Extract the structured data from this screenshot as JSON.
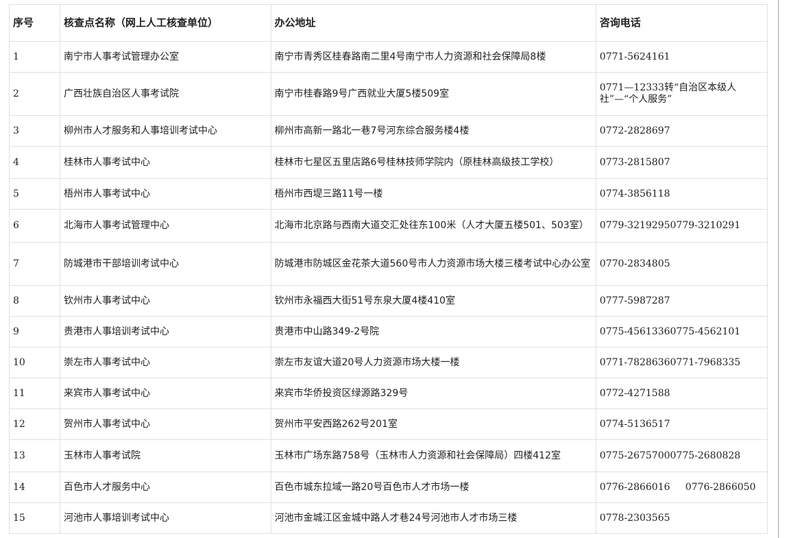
{
  "table": {
    "headers": [
      "序号",
      "核查点名称（网上人工核查单位）",
      "办公地址",
      "咨询电话"
    ],
    "rows": [
      {
        "no": "1",
        "name": "南宁市人事考试管理办公室",
        "address": "南宁市青秀区桂春路南二里4号南宁市人力资源和社会保障局8楼",
        "phone": "0771-5624161"
      },
      {
        "no": "2",
        "name": "广西壮族自治区人事考试院",
        "address": "南宁市桂春路9号广西就业大厦5楼509室",
        "phone": "0771—12333转“自治区本级人社”—“个人服务”"
      },
      {
        "no": "3",
        "name": "柳州市人才服务和人事培训考试中心",
        "address": "柳州市高新一路北一巷7号河东综合服务楼4楼",
        "phone": "0772-2828697"
      },
      {
        "no": "4",
        "name": "桂林市人事考试中心",
        "address": "桂林市七星区五里店路6号桂林技师学院内（原桂林高级技工学校）",
        "phone": "0773-2815807"
      },
      {
        "no": "5",
        "name": "梧州市人事考试中心",
        "address": "梧州市西堤三路11号一楼",
        "phone": "0774-3856118"
      },
      {
        "no": "6",
        "name": "北海市人事考试管理中心",
        "address": "北海市北京路与西南大道交汇处往东100米（人才大厦五楼501、503室）",
        "phone": "0779-32192950779-3210291"
      },
      {
        "no": "7",
        "name": "防城港市干部培训考试中心",
        "address": "防城港市防城区金花茶大道560号市人力资源市场大楼三楼考试中心办公室",
        "phone": "0770-2834805"
      },
      {
        "no": "8",
        "name": "钦州市人事考试中心",
        "address": "钦州市永福西大街51号东泉大厦4楼410室",
        "phone": "0777-5987287"
      },
      {
        "no": "9",
        "name": "贵港市人事培训考试中心",
        "address": "贵港市中山路349-2号院",
        "phone": "0775-45613360775-4562101"
      },
      {
        "no": "10",
        "name": "崇左市人事考试中心",
        "address": "崇左市友谊大道20号人力资源市场大楼一楼",
        "phone": "0771-78286360771-7968335"
      },
      {
        "no": "11",
        "name": "来宾市人事考试中心",
        "address": "来宾市华侨投资区绿源路329号",
        "phone": "0772-4271588"
      },
      {
        "no": "12",
        "name": "贺州市人事考试中心",
        "address": "贺州市平安西路262号201室",
        "phone": "0774-5136517"
      },
      {
        "no": "13",
        "name": "玉林市人事考试院",
        "address": "玉林市广场东路758号（玉林市人力资源和社会保障局）四楼412室",
        "phone": "0775-26757000775-2680828"
      },
      {
        "no": "14",
        "name": "百色市人才服务中心",
        "address": "百色市城东拉域一路20号百色市人才市场一楼",
        "phone": "0776-2866016     0776-2866050"
      },
      {
        "no": "15",
        "name": "河池市人事培训考试中心",
        "address": "河池市金城江区金城中路人才巷24号河池市人才市场三楼",
        "phone": "0778-2303565"
      }
    ]
  }
}
